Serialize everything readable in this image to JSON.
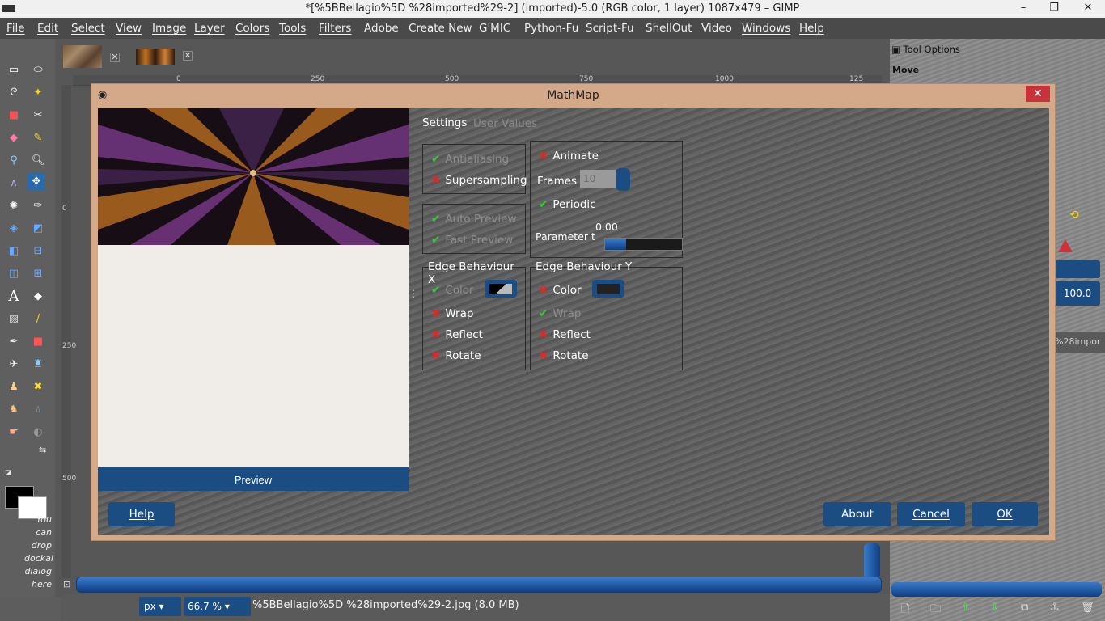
{
  "window": {
    "title": "*[%5BBellagio%5D %28imported%29-2] (imported)-5.0 (RGB color, 1 layer) 1087x479 – GIMP",
    "minimize": "–",
    "maximize": "❐",
    "close": "✕"
  },
  "menu": [
    "File",
    "Edit",
    "Select",
    "View",
    "Image",
    "Layer",
    "Colors",
    "Tools",
    "Filters",
    "Adobe",
    "Create New",
    "G'MIC",
    "Python-Fu",
    "Script-Fu",
    "ShellOut",
    "Video",
    "Windows",
    "Help"
  ],
  "ruler": [
    "0",
    "250",
    "500",
    "750",
    "1000",
    "125"
  ],
  "ruler_left": [
    "0",
    "250",
    "500"
  ],
  "toolbox": {
    "dock_hint": [
      "You",
      "can",
      "drop",
      "dockal",
      "dialog",
      "here"
    ]
  },
  "status": {
    "unit": "px",
    "zoom": "66.7",
    "file": "%5BBellagio%5D %28imported%29-2.jpg (8.0 MB)"
  },
  "dock": {
    "title": "Tool Options",
    "tool": "Move",
    "value": "100.0",
    "layer": "%28impor"
  },
  "dialog": {
    "title": "MathMap",
    "close": "✕",
    "preview_button": "Preview",
    "tabs": {
      "settings": "Settings",
      "user_values": "User Values"
    },
    "options": {
      "antialiasing": "Antialiasing",
      "supersampling": "Supersampling",
      "auto_preview": "Auto Preview",
      "fast_preview": "Fast Preview",
      "animate": "Animate",
      "frames": "Frames",
      "frames_value": "10",
      "periodic": "Periodic",
      "parameter": "Parameter t",
      "parameter_value": "0.00"
    },
    "edge_x": {
      "title": "Edge Behaviour X",
      "color": "Color",
      "wrap": "Wrap",
      "reflect": "Reflect",
      "rotate": "Rotate"
    },
    "edge_y": {
      "title": "Edge Behaviour Y",
      "color": "Color",
      "wrap": "Wrap",
      "reflect": "Reflect",
      "rotate": "Rotate"
    },
    "buttons": {
      "help": "Help",
      "about": "About",
      "cancel": "Cancel",
      "ok": "OK"
    }
  }
}
